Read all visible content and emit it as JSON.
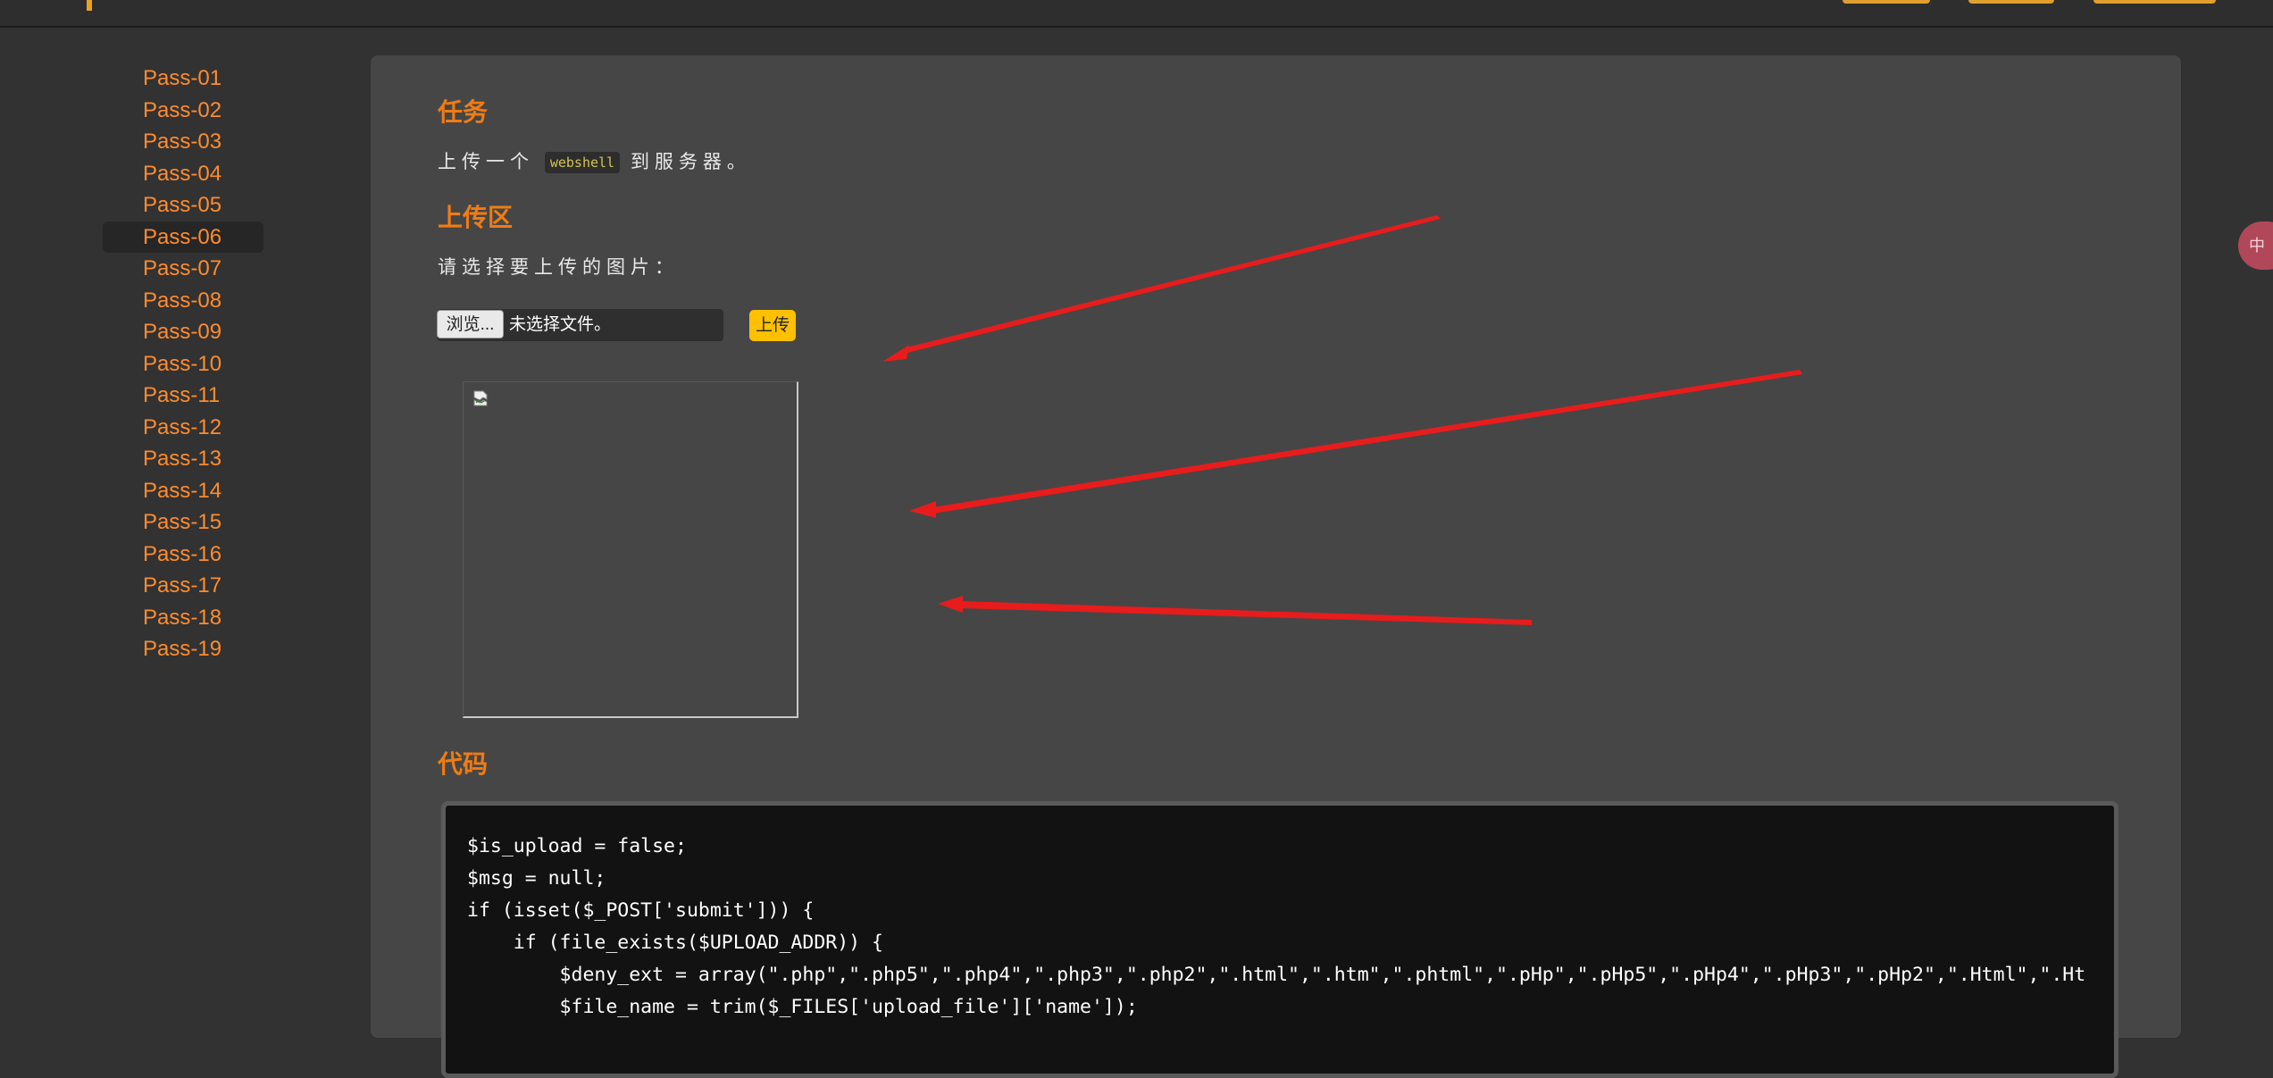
{
  "sidebar": {
    "items": [
      "Pass-01",
      "Pass-02",
      "Pass-03",
      "Pass-04",
      "Pass-05",
      "Pass-06",
      "Pass-07",
      "Pass-08",
      "Pass-09",
      "Pass-10",
      "Pass-11",
      "Pass-12",
      "Pass-13",
      "Pass-14",
      "Pass-15",
      "Pass-16",
      "Pass-17",
      "Pass-18",
      "Pass-19"
    ],
    "active": "Pass-06"
  },
  "task": {
    "heading": "任务",
    "text_before": "上传一个",
    "code_word": "webshell",
    "text_after": "到服务器。"
  },
  "upload": {
    "heading": "上传区",
    "prompt": "请选择要上传的图片：",
    "browse_label": "浏览...",
    "file_status": "未选择文件。",
    "submit_label": "上传"
  },
  "code": {
    "heading": "代码",
    "lines": [
      "$is_upload = false;",
      "$msg = null;",
      "if (isset($_POST['submit'])) {",
      "    if (file_exists($UPLOAD_ADDR)) {",
      "        $deny_ext = array(\".php\",\".php5\",\".php4\",\".php3\",\".php2\",\".html\",\".htm\",\".phtml\",\".pHp\",\".pHp5\",\".pHp4\",\".pHp3\",\".pHp2\",\".Html\",\".Ht",
      "        $file_name = trim($_FILES['upload_file']['name']);"
    ]
  },
  "colors": {
    "accent": "#f07c12",
    "link": "#ff8c2e",
    "upload_button": "#ffc000",
    "annotation_arrow": "#e81c1c"
  },
  "icons": {
    "preview": "broken-image-icon"
  }
}
